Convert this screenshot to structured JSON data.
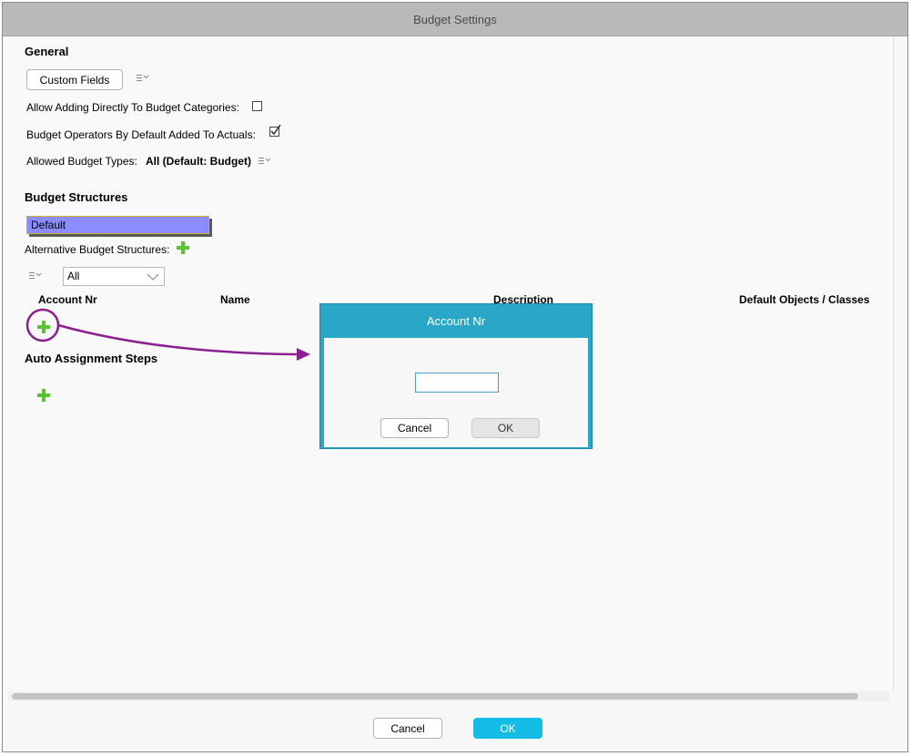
{
  "window": {
    "title": "Budget Settings"
  },
  "general": {
    "title": "General",
    "custom_fields_label": "Custom Fields",
    "allow_adding_label": "Allow Adding Directly To Budget Categories:",
    "allow_adding_checked": false,
    "operators_label": "Budget Operators By Default Added To Actuals:",
    "operators_checked": true,
    "allowed_types_label": "Allowed Budget Types:",
    "allowed_types_value": "All (Default: Budget)"
  },
  "budget_structures": {
    "title": "Budget Structures",
    "default_value": "Default",
    "alternative_label": "Alternative Budget Structures:",
    "filter_value": "All",
    "columns": [
      "Account Nr",
      "Name",
      "Description",
      "Default Objects / Classes"
    ]
  },
  "auto_assignment": {
    "title": "Auto Assignment Steps"
  },
  "dialog": {
    "title": "Account Nr",
    "input_value": "",
    "cancel_label": "Cancel",
    "ok_label": "OK"
  },
  "footer": {
    "cancel_label": "Cancel",
    "ok_label": "OK"
  },
  "colors": {
    "accent": "#14bde6",
    "dialog_header": "#2aa6c6",
    "annotation": "#8b1f8f",
    "plus": "#5bc236",
    "default_field": "#8c8cff"
  }
}
